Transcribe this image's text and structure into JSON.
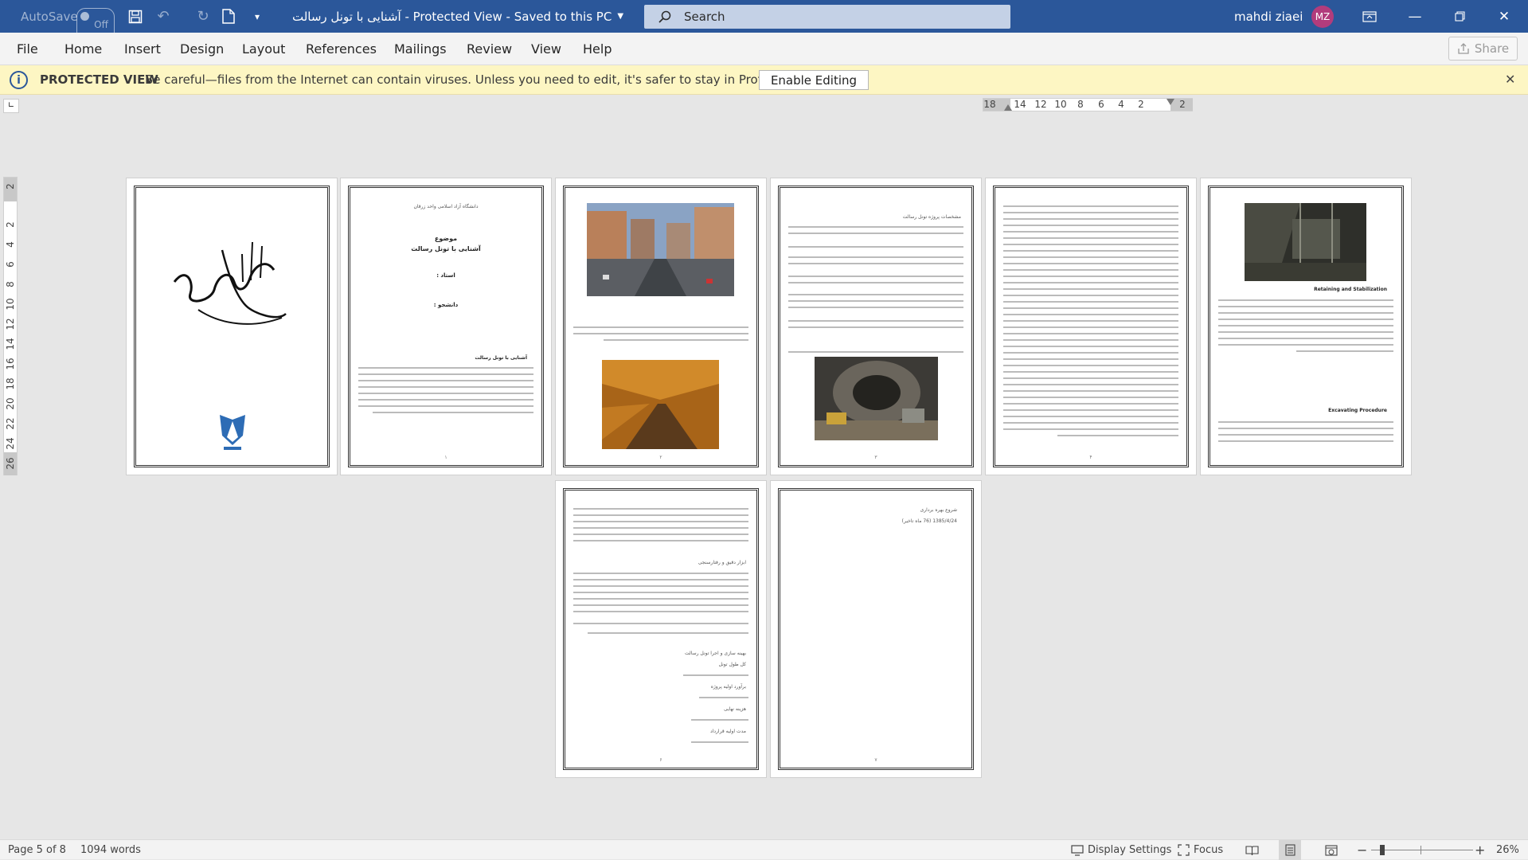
{
  "titlebar": {
    "autosave_label": "AutoSave",
    "autosave_state": "Off",
    "document_title": "آشنایی با تونل رسالت",
    "view_mode": "Protected View",
    "save_status": "Saved to this PC",
    "search_placeholder": "Search",
    "user_name": "mahdi ziaei",
    "user_initials": "MZ",
    "accent_color": "#2b579a"
  },
  "menu": {
    "tabs": [
      "File",
      "Home",
      "Insert",
      "Design",
      "Layout",
      "References",
      "Mailings",
      "Review",
      "View",
      "Help"
    ],
    "share_label": "Share"
  },
  "protected_view": {
    "title": "PROTECTED VIEW",
    "message": "Be careful—files from the Internet can contain viruses. Unless you need to edit, it's safer to stay in Protected View.",
    "enable_button": "Enable Editing",
    "bar_color": "#fdf6c3"
  },
  "ruler": {
    "horizontal_labels": [
      "18",
      "14",
      "12",
      "10",
      "8",
      "6",
      "4",
      "2",
      "2"
    ],
    "vertical_labels": [
      "2",
      "2",
      "4",
      "6",
      "8",
      "10",
      "12",
      "14",
      "16",
      "18",
      "20",
      "22",
      "24",
      "26"
    ]
  },
  "pages": {
    "page2": {
      "university": "دانشگاه آزاد اسلامی واحد زرقان",
      "subject_label": "موضوع",
      "subject": "آشنایی با تونل رسالت",
      "teacher_label": "استاد :",
      "student_label": "دانشجو :",
      "heading": "آشنایی با تونل رسالت"
    },
    "page4": {
      "heading": "مشخصات پروژه تونل رسالت"
    },
    "page6": {
      "section1": "Retaining and Stabilization",
      "section2": "Excavating Procedure"
    },
    "page7": {
      "item1": "ابزار دقیق و رفتارسنجی",
      "item2": "بهینه سازی و اجرا تونل رسالت",
      "item3": "کل طول تونل",
      "item4": "برآورد اولیه پروژه",
      "item5": "هزینه نهایی",
      "item6": "مدت اولیه قرارداد"
    },
    "page8": {
      "line1": "شروع بهره برداری",
      "line2": "1385/4/24 (76 ماه تاخیر)"
    }
  },
  "status": {
    "page_info": "Page 5 of 8",
    "word_count": "1094 words",
    "display_settings": "Display Settings",
    "focus": "Focus",
    "zoom": "26%"
  }
}
